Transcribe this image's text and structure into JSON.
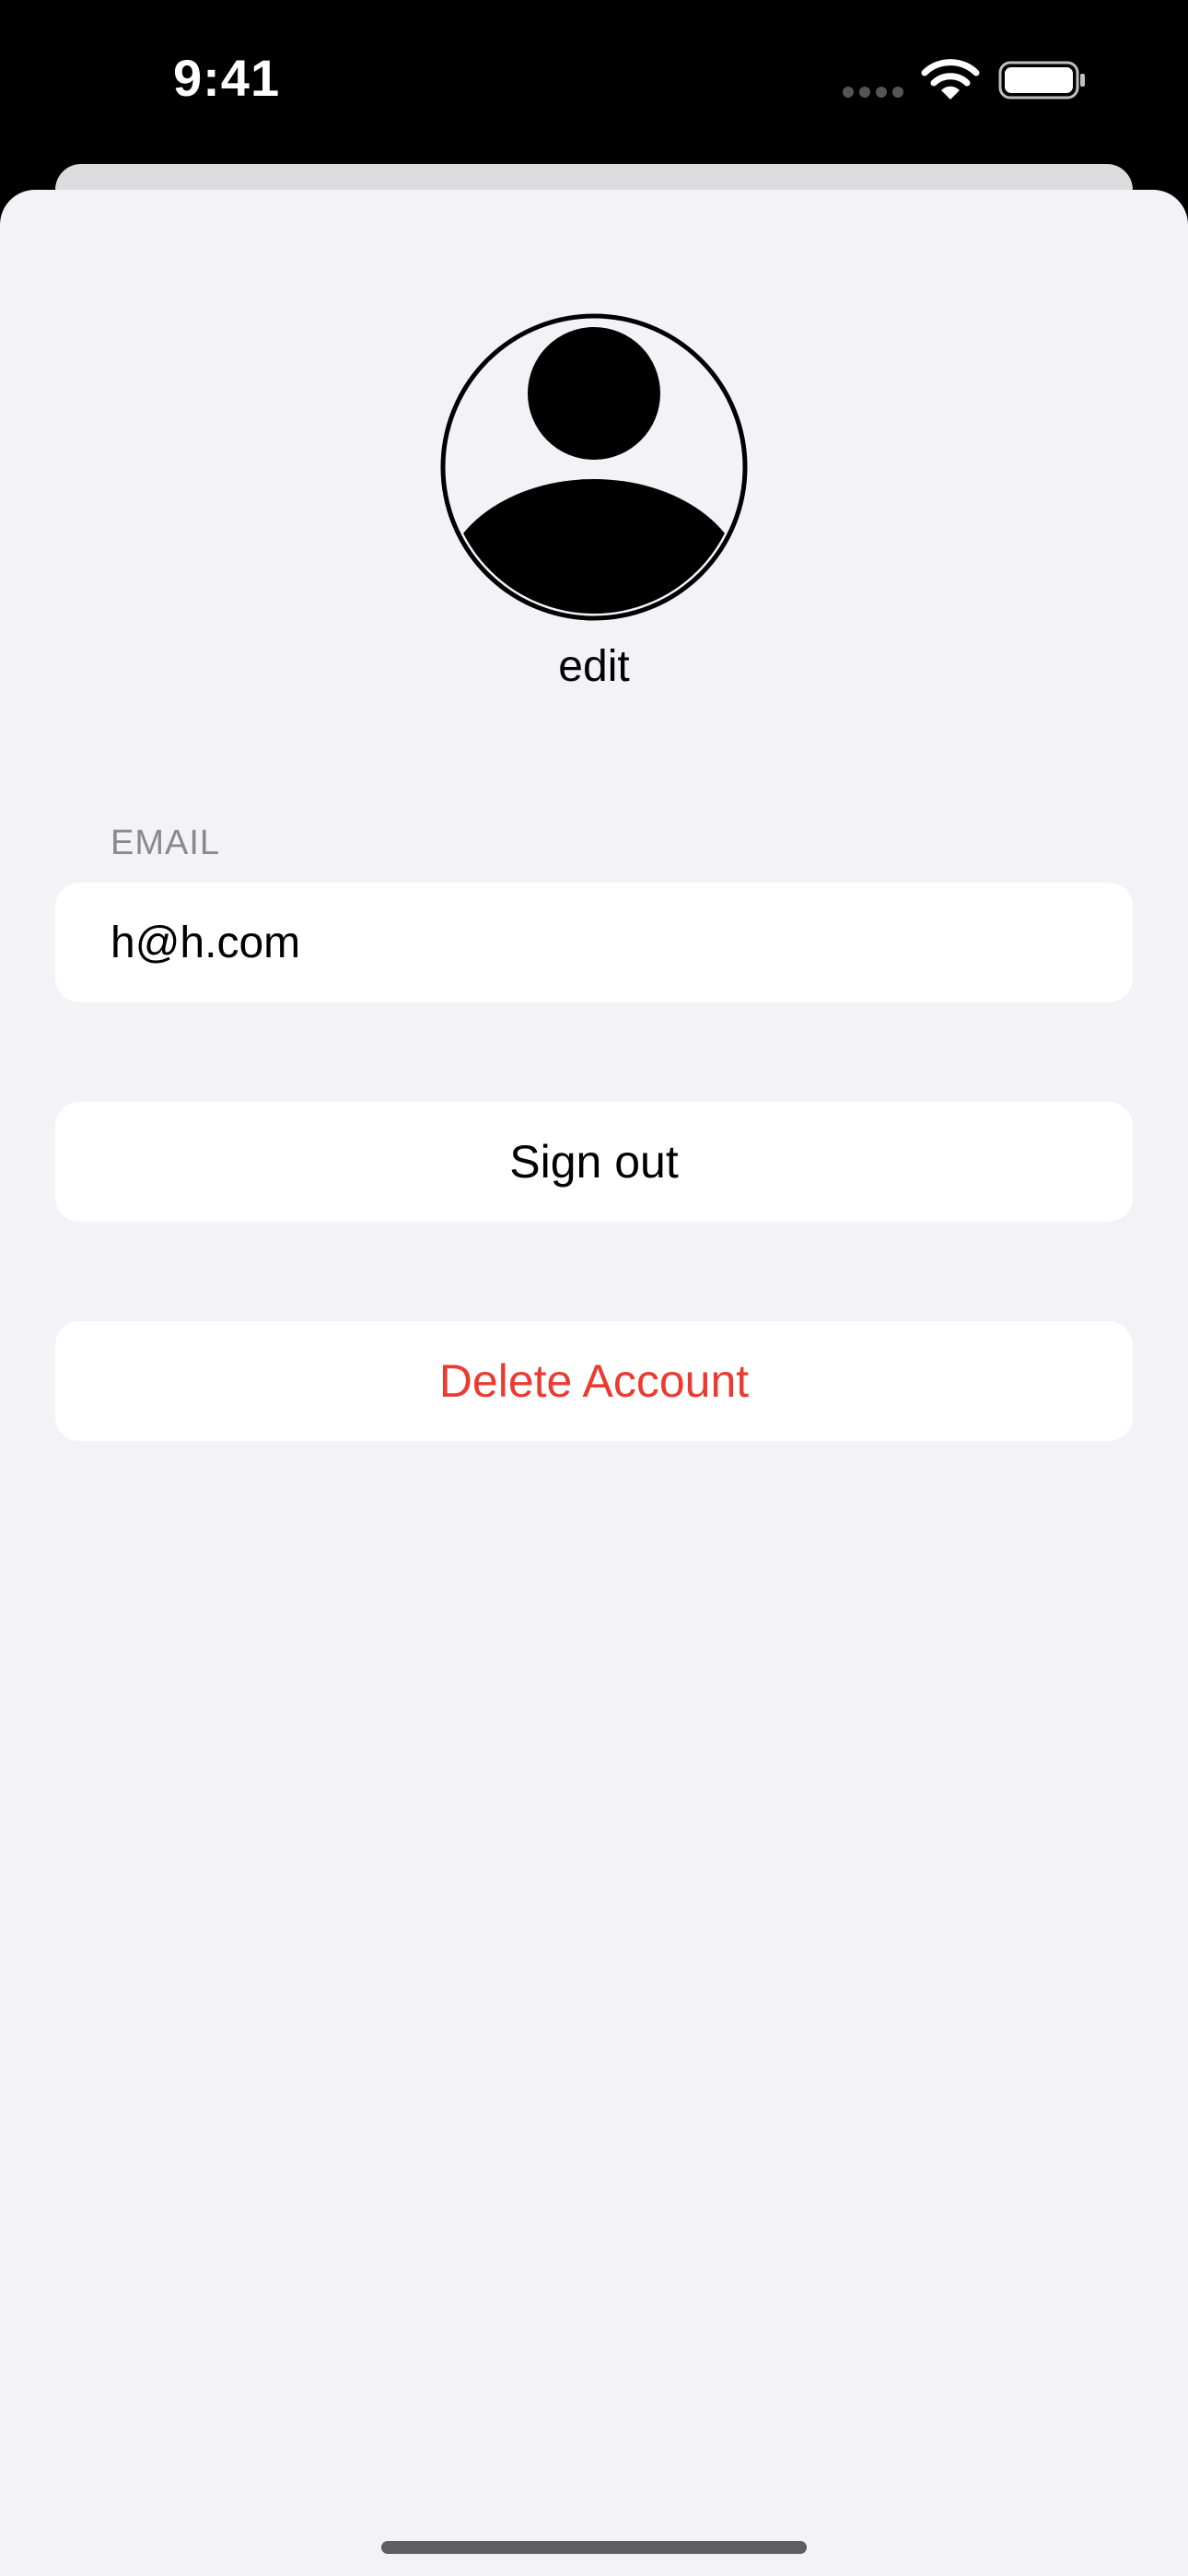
{
  "status_bar": {
    "time": "9:41",
    "icons": [
      "cellular-signal-icon",
      "wifi-icon",
      "battery-icon"
    ]
  },
  "profile": {
    "avatar_icon": "person-circle-icon",
    "edit_label": "edit"
  },
  "account": {
    "email_section_label": "EMAIL",
    "email_value": "h@h.com"
  },
  "actions": {
    "sign_out_label": "Sign out",
    "delete_account_label": "Delete Account"
  },
  "colors": {
    "background": "#f2f2f7",
    "card": "#ffffff",
    "destructive": "#eb3b30",
    "secondary_text": "#8a8a8e"
  }
}
